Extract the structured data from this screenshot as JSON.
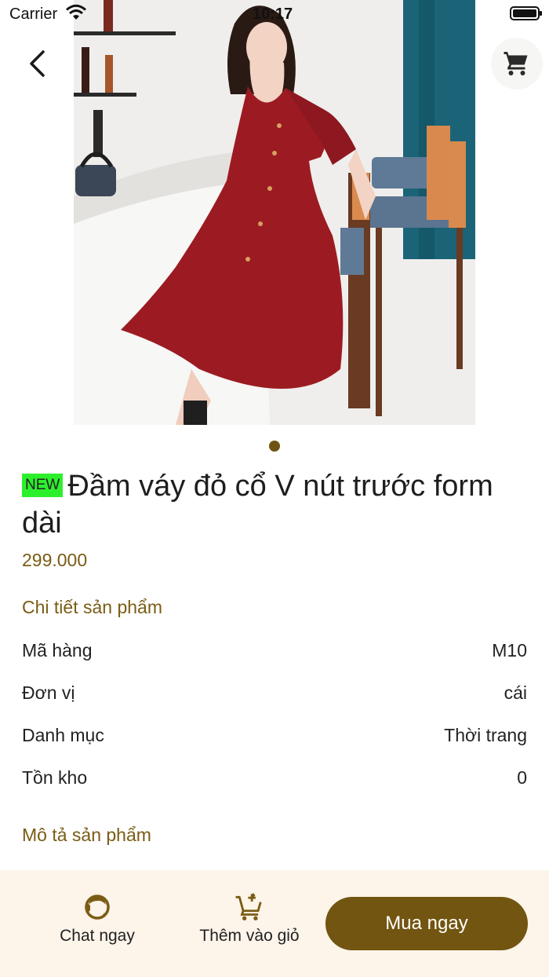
{
  "status_bar": {
    "carrier": "Carrier",
    "time": "10:17"
  },
  "header": {
    "back_icon": "chevron-left-icon",
    "cart_icon": "shopping-cart-icon"
  },
  "gallery": {
    "page_count": 1,
    "active_index": 0,
    "dot_color": "#6e5412"
  },
  "product": {
    "badge": "NEW",
    "badge_color": "#2df02d",
    "name": "Đầm váy đỏ cổ V nút trước form dài",
    "price": "299.000"
  },
  "details": {
    "heading": "Chi tiết sản phẩm",
    "rows": [
      {
        "label": "Mã hàng",
        "value": "M10"
      },
      {
        "label": "Đơn vị",
        "value": "cái"
      },
      {
        "label": "Danh mục",
        "value": "Thời trang"
      },
      {
        "label": "Tồn kho",
        "value": "0"
      }
    ]
  },
  "description": {
    "heading": "Mô tả sản phẩm"
  },
  "bottom_bar": {
    "chat_label": "Chat ngay",
    "add_to_cart_label": "Thêm vào giỏ",
    "buy_label": "Mua ngay",
    "accent_color": "#715510",
    "background_color": "#fdf4ea"
  }
}
